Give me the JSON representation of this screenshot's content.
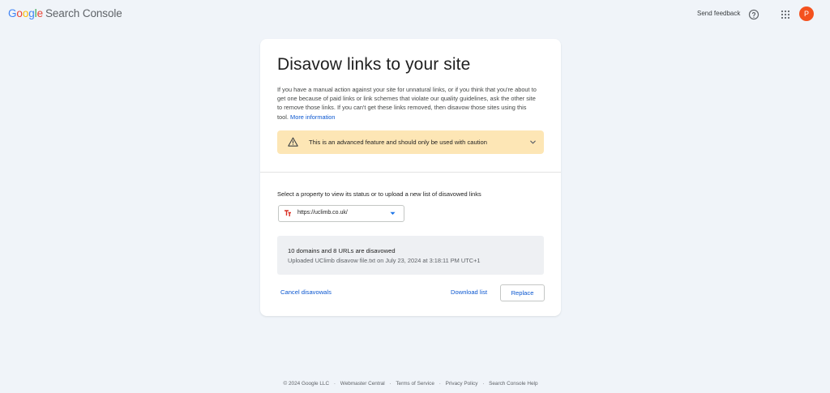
{
  "header": {
    "logo_google": [
      "G",
      "o",
      "o",
      "g",
      "l",
      "e"
    ],
    "product_name": "Search Console",
    "send_feedback": "Send feedback",
    "avatar_initial": "P",
    "avatar_color": "#f4511e",
    "help_icon": "help-circle-icon",
    "apps_icon": "apps-grid-icon"
  },
  "card": {
    "title": "Disavow links to your site",
    "description": "If you have a manual action against your site for unnatural links, or if you think that you're about to get one because of paid links or link schemes that violate our quality guidelines, ask the other site to remove those links. If you can't get these links removed, then disavow those sites using this tool.",
    "more_info_link": "More information",
    "caution": {
      "text": "This is an advanced feature and should only be used with caution",
      "background": "#fde6b5",
      "icon": "warning-icon"
    },
    "select_label": "Select a property to view its status or to upload a new list of disavowed links",
    "property": {
      "value": "https://uclimb.co.uk/",
      "favicon": "site-favicon-icon"
    },
    "status": {
      "summary": "10 domains and 8 URLs are disavowed",
      "upload_info": "Uploaded UClimb disavow file.txt on July 23, 2024 at 3:18:11 PM UTC+1"
    },
    "actions": {
      "cancel": "Cancel disavowals",
      "download": "Download list",
      "replace": "Replace"
    }
  },
  "footer": {
    "copyright": "© 2024 Google LLC",
    "links": [
      "Webmaster Central",
      "Terms of Service",
      "Privacy Policy",
      "Search Console Help"
    ],
    "separator": "·"
  },
  "colors": {
    "accent": "#0b57d0",
    "page_background": "#f0f4f9"
  }
}
